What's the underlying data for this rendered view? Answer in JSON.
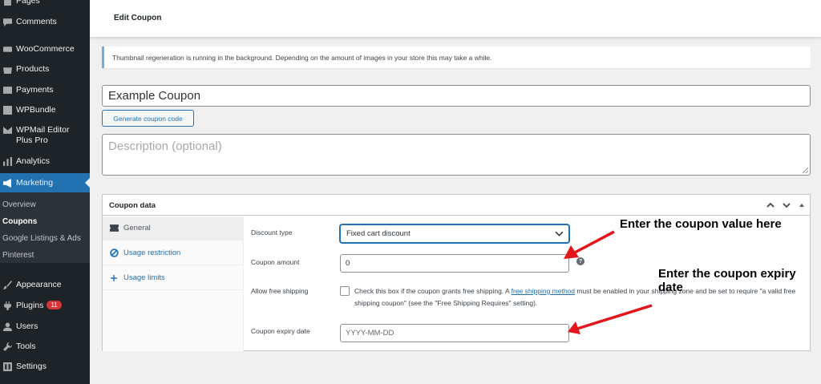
{
  "sidebar": {
    "items": [
      {
        "label": "Pages",
        "icon": "pages-icon"
      },
      {
        "label": "Comments",
        "icon": "comments-icon"
      },
      {
        "label": "WooCommerce",
        "icon": "woocommerce-icon"
      },
      {
        "label": "Products",
        "icon": "products-icon"
      },
      {
        "label": "Payments",
        "icon": "payments-icon"
      },
      {
        "label": "WPBundle",
        "icon": "wpbundle-icon"
      },
      {
        "label": "WPMail Editor Plus Pro",
        "icon": "mail-icon"
      },
      {
        "label": "Analytics",
        "icon": "analytics-icon"
      },
      {
        "label": "Marketing",
        "icon": "megaphone-icon"
      },
      {
        "label": "Appearance",
        "icon": "brush-icon"
      },
      {
        "label": "Plugins",
        "icon": "plugin-icon",
        "badge": "11"
      },
      {
        "label": "Users",
        "icon": "users-icon"
      },
      {
        "label": "Tools",
        "icon": "wrench-icon"
      },
      {
        "label": "Settings",
        "icon": "settings-icon"
      }
    ],
    "submenu": [
      "Overview",
      "Coupons",
      "Google Listings & Ads",
      "Pinterest"
    ]
  },
  "header": {
    "title": "Edit Coupon"
  },
  "notice": {
    "text": "Thumbnail regeneration is running in the background. Depending on the amount of images in your store this may take a while."
  },
  "coupon": {
    "title_value": "Example Coupon",
    "generate_label": "Generate coupon code",
    "description_placeholder": "Description (optional)"
  },
  "panel": {
    "title": "Coupon data",
    "tabs": [
      "General",
      "Usage restriction",
      "Usage limits"
    ],
    "fields": {
      "discount_type_label": "Discount type",
      "discount_type_value": "Fixed cart discount",
      "amount_label": "Coupon amount",
      "amount_value": "0",
      "free_shipping_label": "Allow free shipping",
      "free_shipping_pre": "Check this box if the coupon grants free shipping. A ",
      "free_shipping_link": "free shipping method",
      "free_shipping_post": " must be enabled in your shipping zone and be set to require \"a valid free shipping coupon\" (see the \"Free Shipping Requires\" setting).",
      "expiry_label": "Coupon expiry date",
      "expiry_placeholder": "YYYY-MM-DD"
    }
  },
  "annotations": {
    "value": "Enter the coupon value here",
    "expiry": "Enter the coupon expiry date",
    "arrow_color": "#e4161b"
  },
  "colors": {
    "sidebar_bg": "#1d2327",
    "accent": "#2271b1",
    "badge": "#d63638"
  }
}
